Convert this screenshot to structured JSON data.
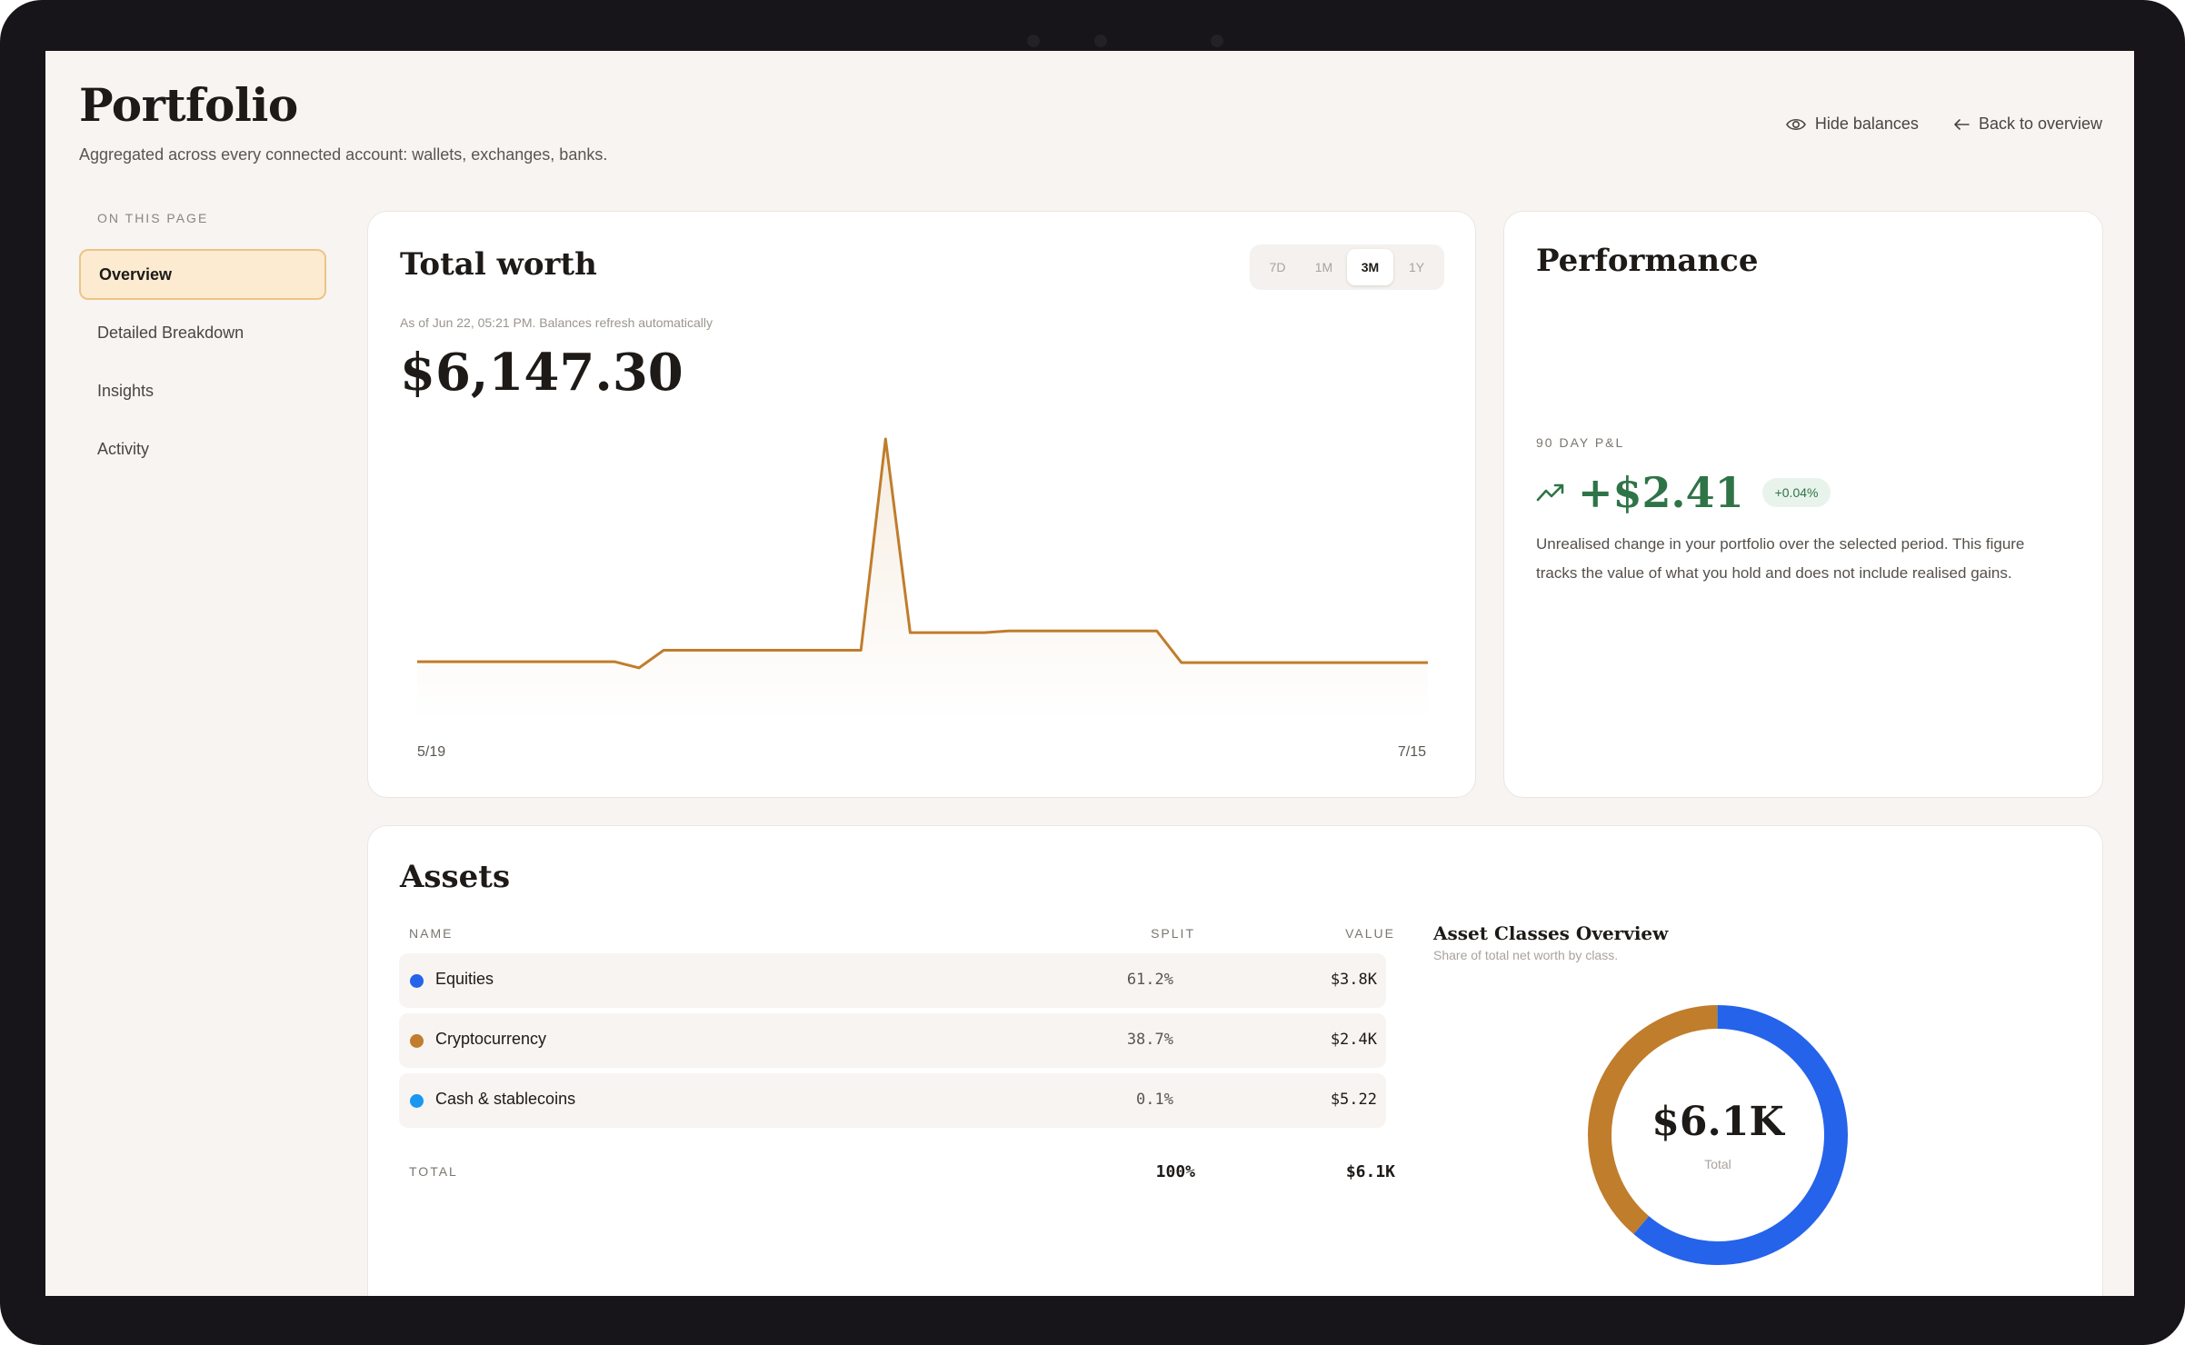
{
  "header": {
    "title": "Portfolio",
    "subtitle": "Aggregated across every connected account: wallets, exchanges, banks.",
    "hide_balances": "Hide balances",
    "back_to_overview": "Back to overview"
  },
  "sidebar": {
    "heading": "ON THIS PAGE",
    "items": [
      {
        "label": "Overview",
        "active": true
      },
      {
        "label": "Detailed Breakdown"
      },
      {
        "label": "Insights"
      },
      {
        "label": "Activity"
      }
    ]
  },
  "total_worth": {
    "title": "Total worth",
    "ranges": [
      "7D",
      "1M",
      "3M",
      "1Y"
    ],
    "selected_range": "3M",
    "as_of": "As of Jun 22, 05:21 PM. Balances refresh automatically",
    "value": "$6,147.30",
    "chart_data": {
      "type": "line",
      "x_start_label": "5/19",
      "x_end_label": "7/15",
      "color": "#c07d2c",
      "values": [
        6147,
        6147,
        6147,
        6147,
        6147,
        6147,
        6147,
        6147,
        6147,
        6140,
        6160,
        6160,
        6160,
        6160,
        6160,
        6160,
        6160,
        6160,
        6160,
        6400,
        6180,
        6180,
        6180,
        6180,
        6182,
        6182,
        6182,
        6182,
        6182,
        6182,
        6182,
        6146,
        6146,
        6146,
        6146,
        6146,
        6146,
        6146,
        6146,
        6146,
        6146,
        6146
      ]
    }
  },
  "performance": {
    "title": "Performance",
    "kicker": "90 DAY P&L",
    "value": "+$2.41",
    "badge": "+0.04%",
    "description": "Unrealised change in your portfolio over the selected period. This figure tracks the value of what you hold and does not include realised gains.",
    "accent": "#2f7447"
  },
  "assets": {
    "title": "Assets",
    "columns": {
      "name": "NAME",
      "split": "SPLIT",
      "value": "VALUE"
    },
    "rows": [
      {
        "name": "Equities",
        "split": "61.2%",
        "value": "$3.8K",
        "color": "#2563eb"
      },
      {
        "name": "Cryptocurrency",
        "split": "38.7%",
        "value": "$2.4K",
        "color": "#c07d2c"
      },
      {
        "name": "Cash & stablecoins",
        "split": "0.1%",
        "value": "$5.22",
        "color": "#1a97f0"
      }
    ],
    "total": {
      "label": "TOTAL",
      "split": "100%",
      "value": "$6.1K"
    },
    "donut": {
      "title": "Asset Classes Overview",
      "subtitle": "Share of total net worth by class.",
      "center_value": "$6.1K",
      "center_label": "Total",
      "chart_data": {
        "type": "pie",
        "labels": [
          "Equities",
          "Cryptocurrency",
          "Cash & stablecoins"
        ],
        "values": [
          61.2,
          38.7,
          0.1
        ],
        "colors": [
          "#2563eb",
          "#c07d2c",
          "#1a97f0"
        ]
      }
    }
  }
}
